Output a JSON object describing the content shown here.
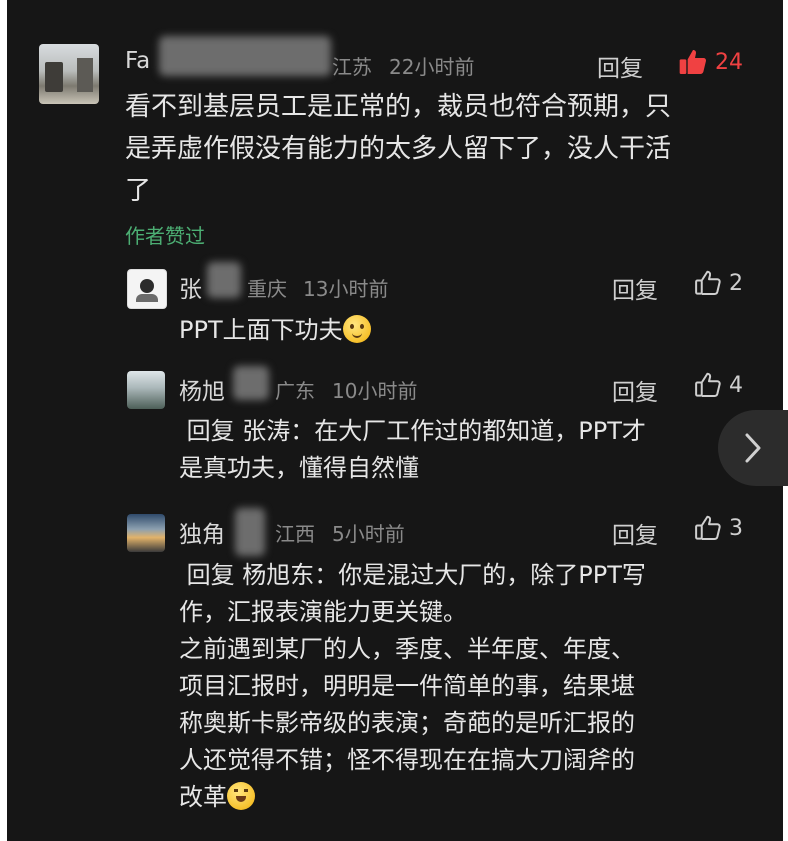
{
  "comment": {
    "username_visible": "Fa",
    "location": "江苏",
    "time": "22小时前",
    "reply_label": "回复",
    "like_count": "24",
    "text": "看不到基层员工是正常的，裁员也符合预期，只\n是弄虚作假没有能力的太多人留下了，没人干活\n了",
    "author_liked": "作者赞过"
  },
  "replies": [
    {
      "username_visible": "张",
      "location": "重庆",
      "time": "13小时前",
      "reply_label": "回复",
      "like_count": "2",
      "text": "PPT上面下功夫"
    },
    {
      "username_visible": "杨旭",
      "location": "广东",
      "time": "10小时前",
      "reply_label": "回复",
      "like_count": "4",
      "text": " 回复 张涛：在大厂工作过的都知道，PPT才\n是真功夫，懂得自然懂"
    },
    {
      "username_visible": "独角",
      "location": "江西",
      "time": "5小时前",
      "reply_label": "回复",
      "like_count": "3",
      "text_lines": [
        " 回复 杨旭东：你是混过大厂的，除了PPT写",
        "作，汇报表演能力更关键。",
        "之前遇到某厂的人，季度、半年度、年度、",
        "项目汇报时，明明是一件简单的事，结果堪",
        "称奥斯卡影帝级的表演；奇葩的是听汇报的",
        "人还觉得不错；怪不得现在在搞大刀阔斧的",
        "改革"
      ]
    }
  ],
  "colors": {
    "background": "#161616",
    "liked": "#f04142",
    "author_liked": "#4cae73"
  }
}
